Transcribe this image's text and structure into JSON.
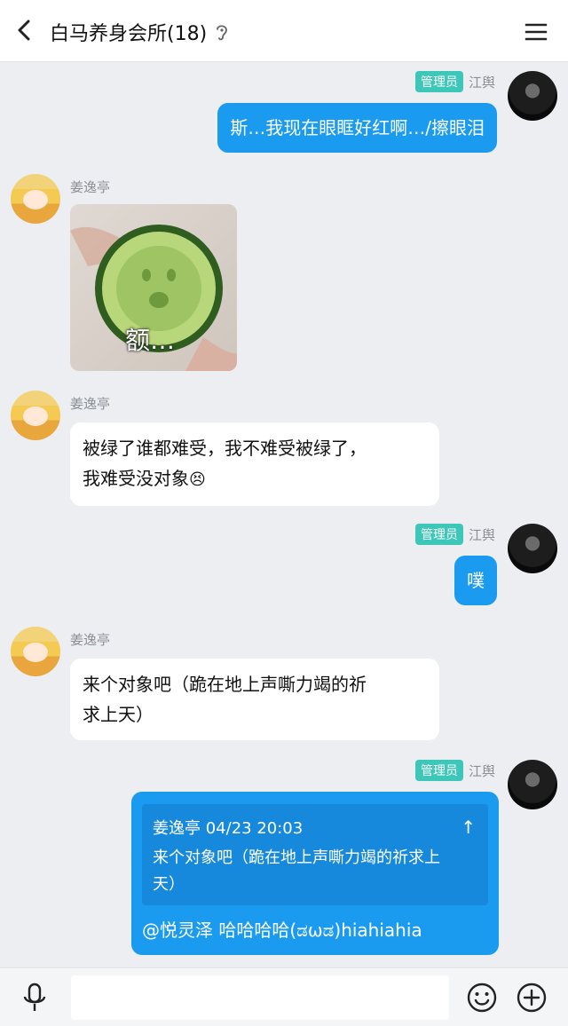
{
  "header": {
    "title": "白马养身会所(18)"
  },
  "messages": {
    "m1": {
      "badge": "管理员",
      "sender": "江舆",
      "text": "斯…我现在眼眶好红啊…/擦眼泪"
    },
    "m2": {
      "sender": "姜逸亭",
      "sticker_text": "额…"
    },
    "m3": {
      "sender": "姜逸亭",
      "line1": "被绿了谁都难受，我不难受被绿了，",
      "line2": "我难受没对象",
      "emoji": "😣"
    },
    "m4": {
      "badge": "管理员",
      "sender": "江舆",
      "text": "噗"
    },
    "m5": {
      "sender": "姜逸亭",
      "line1": "来个对象吧（跪在地上声嘶力竭的祈",
      "line2": "求上天）"
    },
    "m6": {
      "badge": "管理员",
      "sender": "江舆",
      "quote_header": "姜逸亭 04/23 20:03",
      "quote_arrow": "↑",
      "quote_line1": "来个对象吧（跪在地上声嘶力竭的祈求上",
      "quote_line2": "天）",
      "text": "@悦灵泽 哈哈哈哈(ಡωಡ)hiahiahia"
    }
  },
  "colors": {
    "bubble_self": "#1b9bf0",
    "admin_badge": "#3cc7b8",
    "chat_background": "#eceef1"
  },
  "icons": {
    "back": "back-arrow-icon",
    "ear": "ear-icon",
    "menu": "menu-icon",
    "voice": "microphone-icon",
    "emoji": "emoji-icon",
    "plus": "plus-icon"
  }
}
